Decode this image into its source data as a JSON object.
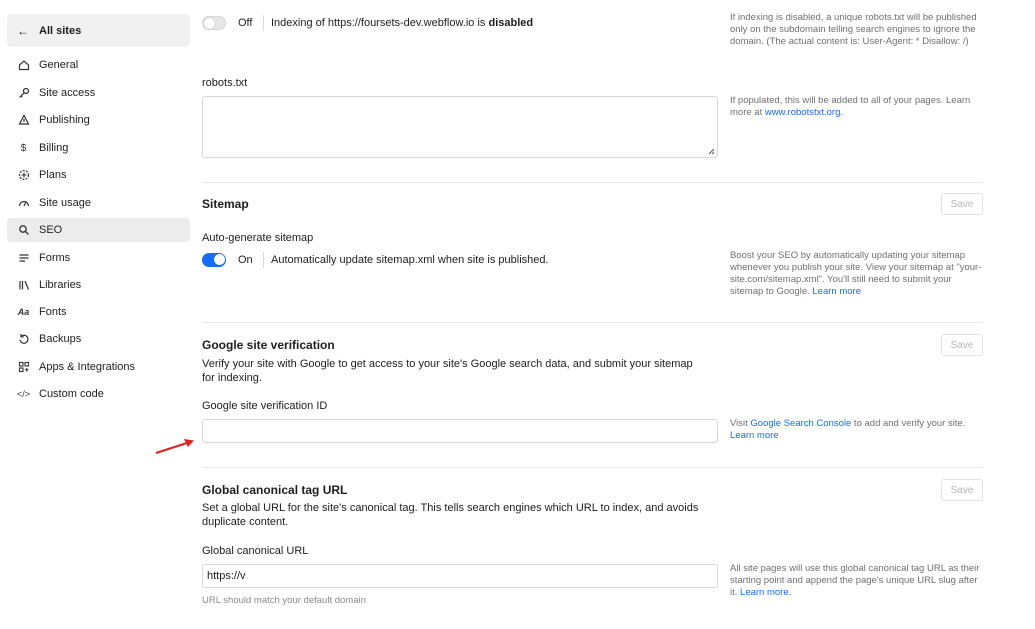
{
  "sidebar": {
    "back_label": "All sites",
    "items": [
      {
        "label": "General",
        "icon": "home-icon"
      },
      {
        "label": "Site access",
        "icon": "key-icon"
      },
      {
        "label": "Publishing",
        "icon": "publish-icon"
      },
      {
        "label": "Billing",
        "icon": "dollar-icon"
      },
      {
        "label": "Plans",
        "icon": "plans-icon"
      },
      {
        "label": "Site usage",
        "icon": "gauge-icon"
      },
      {
        "label": "SEO",
        "icon": "search-icon",
        "active": true
      },
      {
        "label": "Forms",
        "icon": "forms-icon"
      },
      {
        "label": "Libraries",
        "icon": "libraries-icon"
      },
      {
        "label": "Fonts",
        "icon": "fonts-icon"
      },
      {
        "label": "Backups",
        "icon": "backup-icon"
      },
      {
        "label": "Apps & Integrations",
        "icon": "apps-icon"
      },
      {
        "label": "Custom code",
        "icon": "code-icon"
      }
    ]
  },
  "indexing": {
    "toggle_state": "Off",
    "text_prefix": "Indexing of https://foursets-dev.webflow.io is ",
    "text_bold": "disabled",
    "help": "If indexing is disabled, a unique robots.txt will be published only on the subdomain telling search engines to ignore the domain. (The actual content is: User-Agent: * Disallow: /)"
  },
  "robots": {
    "label": "robots.txt",
    "value": "",
    "help_prefix": "If populated, this will be added to all of your pages. Learn more at ",
    "help_link": "www.robotstxt.org",
    "help_suffix": "."
  },
  "sitemap": {
    "title": "Sitemap",
    "save_label": "Save",
    "auto_label": "Auto-generate sitemap",
    "toggle_state": "On",
    "toggle_text": "Automatically update sitemap.xml when site is published.",
    "help": "Boost your SEO by automatically updating your sitemap whenever you publish your site. View your sitemap at \"your-site.com/sitemap.xml\". You'll still need to submit your sitemap to Google. ",
    "help_link": "Learn more"
  },
  "verification": {
    "title": "Google site verification",
    "save_label": "Save",
    "desc": "Verify your site with Google to get access to your site's Google search data, and submit your sitemap for indexing.",
    "field_label": "Google site verification ID",
    "value": "",
    "help_prefix": "Visit ",
    "help_link1": "Google Search Console",
    "help_mid": " to add and verify your site. ",
    "help_link2": "Learn more"
  },
  "canonical": {
    "title": "Global canonical tag URL",
    "save_label": "Save",
    "desc": "Set a global URL for the site's canonical tag. This tells search engines which URL to index, and avoids duplicate content.",
    "field_label": "Global canonical URL",
    "value": "https://v",
    "hint": "URL should match your default domain",
    "help_prefix": "All site pages will use this global canonical tag URL as their starting point and append the page's unique URL slug after it. ",
    "help_link": "Learn more."
  },
  "colors": {
    "accent": "#146ef5",
    "annotation_arrow": "#e02020"
  }
}
